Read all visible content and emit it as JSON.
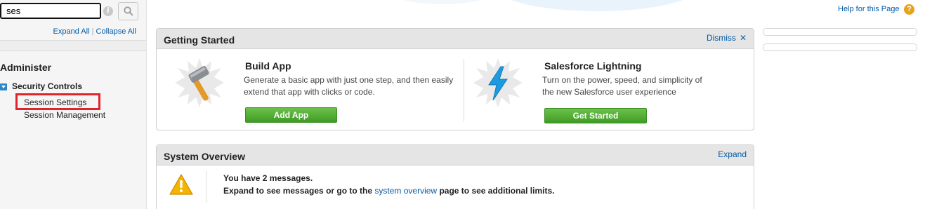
{
  "search": {
    "value": "ses",
    "info_icon": "i"
  },
  "sidebar": {
    "expand_all": "Expand All",
    "separator": "|",
    "collapse_all": "Collapse All",
    "section_title": "Administer",
    "tree": {
      "parent": "Security Controls",
      "children": [
        "Session Settings",
        "Session Management"
      ]
    }
  },
  "header": {
    "help_link": "Help for this Page",
    "help_icon": "?"
  },
  "getting_started": {
    "title": "Getting Started",
    "dismiss": "Dismiss",
    "dismiss_icon": "✕",
    "cards": [
      {
        "title": "Build App",
        "description": "Generate a basic app with just one step, and then easily extend that app with clicks or code.",
        "button": "Add App",
        "icon": "hammer-icon"
      },
      {
        "title": "Salesforce Lightning",
        "description": "Turn on the power, speed, and simplicity of the new Salesforce user experience",
        "button": "Get Started",
        "icon": "lightning-icon"
      }
    ]
  },
  "system_overview": {
    "title": "System Overview",
    "expand": "Expand",
    "line1": "You have 2 messages.",
    "line2_prefix": "Expand to see messages or go to the",
    "line2_link": "system overview",
    "line2_suffix": "page to see additional limits.",
    "icon": "warning-icon"
  },
  "colors": {
    "link": "#015ba7",
    "button_green": "#4aa52f",
    "highlight_red": "#e0242c",
    "help_orange": "#e8a21b",
    "warning_yellow": "#f4b400"
  }
}
